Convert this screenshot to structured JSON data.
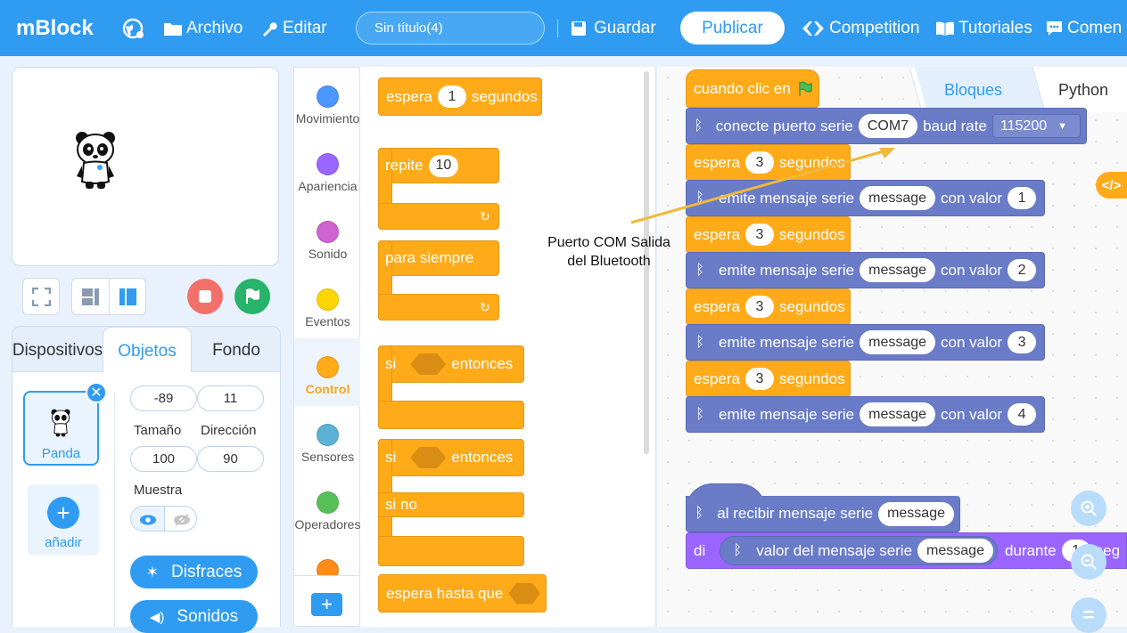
{
  "topbar": {
    "logo": "mBlock",
    "file": "Archivo",
    "edit": "Editar",
    "project_title": "Sin título(4)",
    "save": "Guardar",
    "publish": "Publicar",
    "competition": "Competition",
    "tutorials": "Tutoriales",
    "comments": "Comen"
  },
  "sprite_tabs": {
    "devices": "Dispositivos",
    "objects": "Objetos",
    "background": "Fondo"
  },
  "sprite": {
    "name": "Panda",
    "add": "añadir",
    "x": "-89",
    "y": "11",
    "size_label": "Tamaño",
    "size": "100",
    "direction_label": "Dirección",
    "direction": "90",
    "show_label": "Muestra",
    "costumes": "Disfraces",
    "sounds": "Sonidos"
  },
  "categories": [
    {
      "label": "Movimiento",
      "color": "#4c97ff"
    },
    {
      "label": "Apariencia",
      "color": "#9966ff"
    },
    {
      "label": "Sonido",
      "color": "#cf63cf"
    },
    {
      "label": "Eventos",
      "color": "#ffd500"
    },
    {
      "label": "Control",
      "color": "#ffab19"
    },
    {
      "label": "Sensores",
      "color": "#5cb1d6"
    },
    {
      "label": "Operadores",
      "color": "#59c059"
    },
    {
      "label": "",
      "color": "#ff8c1a"
    }
  ],
  "palette": {
    "wait": "espera",
    "wait_val": "1",
    "seconds": "segundos",
    "repeat": "repite",
    "repeat_val": "10",
    "forever": "para siempre",
    "if": "si",
    "then": "entonces",
    "if2": "si",
    "then2": "entonces",
    "else": "si no",
    "wait_until": "espera hasta que"
  },
  "workspace": {
    "mode_blocks": "Bloques",
    "mode_python": "Python",
    "when_flag": "cuando clic en",
    "connect": "conecte puerto serie",
    "port": "COM7",
    "baud": "baud rate",
    "baud_val": "115200",
    "wait": "espera",
    "wait_val": "3",
    "seconds": "segundos",
    "emit": "emite mensaje serie",
    "message": "message",
    "with_value": "con valor",
    "v1": "1",
    "v2": "2",
    "v3": "3",
    "v4": "4",
    "on_receive": "al recibir mensaje serie",
    "say": "di",
    "serial_value": "valor del mensaje serie",
    "during": "durante",
    "during_val": "1",
    "seg": "seg"
  },
  "annotation": {
    "line1": "Puerto COM Salida",
    "line2": "del Bluetooth"
  },
  "colors": {
    "accent": "#2f9cf2",
    "control": "#ffab19",
    "bluetooth_block": "#6a7cc7",
    "looks": "#9a66ff"
  }
}
